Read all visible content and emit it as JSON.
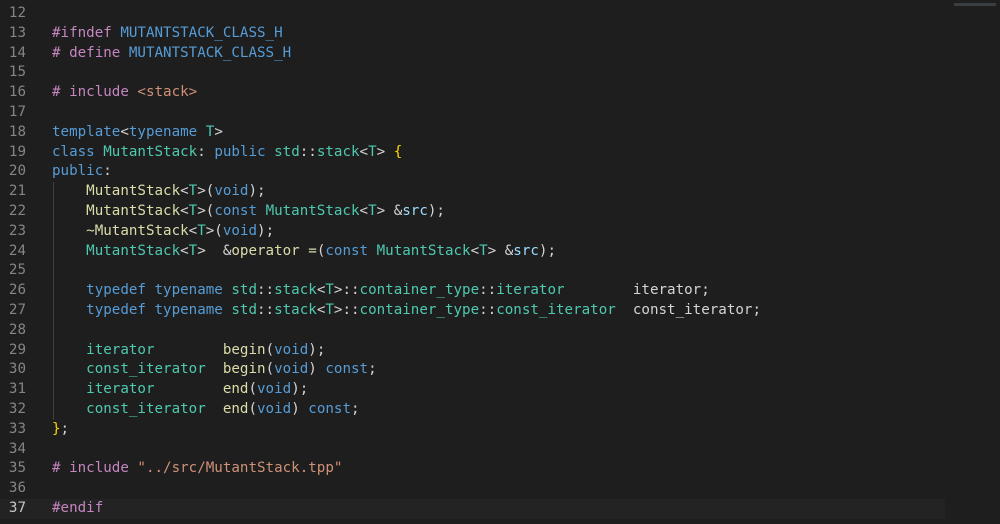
{
  "editor": {
    "active_line": "37",
    "lines": [
      {
        "n": "12",
        "tokens": []
      },
      {
        "n": "13",
        "tokens": [
          {
            "t": "#ifndef ",
            "c": "dir"
          },
          {
            "t": "MUTANTSTACK_CLASS_H",
            "c": "mac"
          }
        ]
      },
      {
        "n": "14",
        "tokens": [
          {
            "t": "# define ",
            "c": "dir"
          },
          {
            "t": "MUTANTSTACK_CLASS_H",
            "c": "mac"
          }
        ]
      },
      {
        "n": "15",
        "tokens": []
      },
      {
        "n": "16",
        "tokens": [
          {
            "t": "# include ",
            "c": "dir"
          },
          {
            "t": "<stack>",
            "c": "str"
          }
        ]
      },
      {
        "n": "17",
        "tokens": []
      },
      {
        "n": "18",
        "tokens": [
          {
            "t": "template",
            "c": "kw"
          },
          {
            "t": "<",
            "c": "plain"
          },
          {
            "t": "typename",
            "c": "kw"
          },
          {
            "t": " ",
            "c": "plain"
          },
          {
            "t": "T",
            "c": "type"
          },
          {
            "t": ">",
            "c": "plain"
          }
        ]
      },
      {
        "n": "19",
        "tokens": [
          {
            "t": "class ",
            "c": "kw"
          },
          {
            "t": "MutantStack",
            "c": "type"
          },
          {
            "t": ": ",
            "c": "plain"
          },
          {
            "t": "public ",
            "c": "kw"
          },
          {
            "t": "std",
            "c": "type"
          },
          {
            "t": "::",
            "c": "plain"
          },
          {
            "t": "stack",
            "c": "type"
          },
          {
            "t": "<",
            "c": "plain"
          },
          {
            "t": "T",
            "c": "type"
          },
          {
            "t": "> ",
            "c": "plain"
          },
          {
            "t": "{",
            "c": "brace"
          }
        ]
      },
      {
        "n": "20",
        "tokens": [
          {
            "t": "public",
            "c": "kw"
          },
          {
            "t": ":",
            "c": "plain"
          }
        ]
      },
      {
        "n": "21",
        "tokens": [
          {
            "t": "    MutantStack",
            "c": "fn"
          },
          {
            "t": "<",
            "c": "plain"
          },
          {
            "t": "T",
            "c": "type"
          },
          {
            "t": ">(",
            "c": "plain"
          },
          {
            "t": "void",
            "c": "kw"
          },
          {
            "t": ");",
            "c": "plain"
          }
        ]
      },
      {
        "n": "22",
        "tokens": [
          {
            "t": "    MutantStack",
            "c": "fn"
          },
          {
            "t": "<",
            "c": "plain"
          },
          {
            "t": "T",
            "c": "type"
          },
          {
            "t": ">(",
            "c": "plain"
          },
          {
            "t": "const ",
            "c": "kw"
          },
          {
            "t": "MutantStack",
            "c": "type"
          },
          {
            "t": "<",
            "c": "plain"
          },
          {
            "t": "T",
            "c": "type"
          },
          {
            "t": "> &",
            "c": "plain"
          },
          {
            "t": "src",
            "c": "var"
          },
          {
            "t": ");",
            "c": "plain"
          }
        ]
      },
      {
        "n": "23",
        "tokens": [
          {
            "t": "    ~MutantStack",
            "c": "fn"
          },
          {
            "t": "<",
            "c": "plain"
          },
          {
            "t": "T",
            "c": "type"
          },
          {
            "t": ">(",
            "c": "plain"
          },
          {
            "t": "void",
            "c": "kw"
          },
          {
            "t": ");",
            "c": "plain"
          }
        ]
      },
      {
        "n": "24",
        "tokens": [
          {
            "t": "    MutantStack",
            "c": "type"
          },
          {
            "t": "<",
            "c": "plain"
          },
          {
            "t": "T",
            "c": "type"
          },
          {
            "t": ">  &",
            "c": "plain"
          },
          {
            "t": "operator =",
            "c": "fn"
          },
          {
            "t": "(",
            "c": "plain"
          },
          {
            "t": "const ",
            "c": "kw"
          },
          {
            "t": "MutantStack",
            "c": "type"
          },
          {
            "t": "<",
            "c": "plain"
          },
          {
            "t": "T",
            "c": "type"
          },
          {
            "t": "> &",
            "c": "plain"
          },
          {
            "t": "src",
            "c": "var"
          },
          {
            "t": ");",
            "c": "plain"
          }
        ]
      },
      {
        "n": "25",
        "tokens": []
      },
      {
        "n": "26",
        "tokens": [
          {
            "t": "    typedef ",
            "c": "kw"
          },
          {
            "t": "typename ",
            "c": "kw"
          },
          {
            "t": "std",
            "c": "type"
          },
          {
            "t": "::",
            "c": "plain"
          },
          {
            "t": "stack",
            "c": "type"
          },
          {
            "t": "<",
            "c": "plain"
          },
          {
            "t": "T",
            "c": "type"
          },
          {
            "t": ">::",
            "c": "plain"
          },
          {
            "t": "container_type",
            "c": "type"
          },
          {
            "t": "::",
            "c": "plain"
          },
          {
            "t": "iterator",
            "c": "type"
          },
          {
            "t": "        iterator;",
            "c": "plain"
          }
        ]
      },
      {
        "n": "27",
        "tokens": [
          {
            "t": "    typedef ",
            "c": "kw"
          },
          {
            "t": "typename ",
            "c": "kw"
          },
          {
            "t": "std",
            "c": "type"
          },
          {
            "t": "::",
            "c": "plain"
          },
          {
            "t": "stack",
            "c": "type"
          },
          {
            "t": "<",
            "c": "plain"
          },
          {
            "t": "T",
            "c": "type"
          },
          {
            "t": ">::",
            "c": "plain"
          },
          {
            "t": "container_type",
            "c": "type"
          },
          {
            "t": "::",
            "c": "plain"
          },
          {
            "t": "const_iterator",
            "c": "type"
          },
          {
            "t": "  const_iterator;",
            "c": "plain"
          }
        ]
      },
      {
        "n": "28",
        "tokens": []
      },
      {
        "n": "29",
        "tokens": [
          {
            "t": "    iterator",
            "c": "type"
          },
          {
            "t": "        ",
            "c": "plain"
          },
          {
            "t": "begin",
            "c": "fn"
          },
          {
            "t": "(",
            "c": "plain"
          },
          {
            "t": "void",
            "c": "kw"
          },
          {
            "t": ");",
            "c": "plain"
          }
        ]
      },
      {
        "n": "30",
        "tokens": [
          {
            "t": "    const_iterator",
            "c": "type"
          },
          {
            "t": "  ",
            "c": "plain"
          },
          {
            "t": "begin",
            "c": "fn"
          },
          {
            "t": "(",
            "c": "plain"
          },
          {
            "t": "void",
            "c": "kw"
          },
          {
            "t": ") ",
            "c": "plain"
          },
          {
            "t": "const",
            "c": "kw"
          },
          {
            "t": ";",
            "c": "plain"
          }
        ]
      },
      {
        "n": "31",
        "tokens": [
          {
            "t": "    iterator",
            "c": "type"
          },
          {
            "t": "        ",
            "c": "plain"
          },
          {
            "t": "end",
            "c": "fn"
          },
          {
            "t": "(",
            "c": "plain"
          },
          {
            "t": "void",
            "c": "kw"
          },
          {
            "t": ");",
            "c": "plain"
          }
        ]
      },
      {
        "n": "32",
        "tokens": [
          {
            "t": "    const_iterator",
            "c": "type"
          },
          {
            "t": "  ",
            "c": "plain"
          },
          {
            "t": "end",
            "c": "fn"
          },
          {
            "t": "(",
            "c": "plain"
          },
          {
            "t": "void",
            "c": "kw"
          },
          {
            "t": ") ",
            "c": "plain"
          },
          {
            "t": "const",
            "c": "kw"
          },
          {
            "t": ";",
            "c": "plain"
          }
        ]
      },
      {
        "n": "33",
        "tokens": [
          {
            "t": "}",
            "c": "brace"
          },
          {
            "t": ";",
            "c": "plain"
          }
        ]
      },
      {
        "n": "34",
        "tokens": []
      },
      {
        "n": "35",
        "tokens": [
          {
            "t": "# include ",
            "c": "dir"
          },
          {
            "t": "\"../src/MutantStack.tpp\"",
            "c": "str"
          }
        ]
      },
      {
        "n": "36",
        "tokens": []
      },
      {
        "n": "37",
        "tokens": [
          {
            "t": "#endif",
            "c": "dir"
          }
        ]
      }
    ]
  }
}
